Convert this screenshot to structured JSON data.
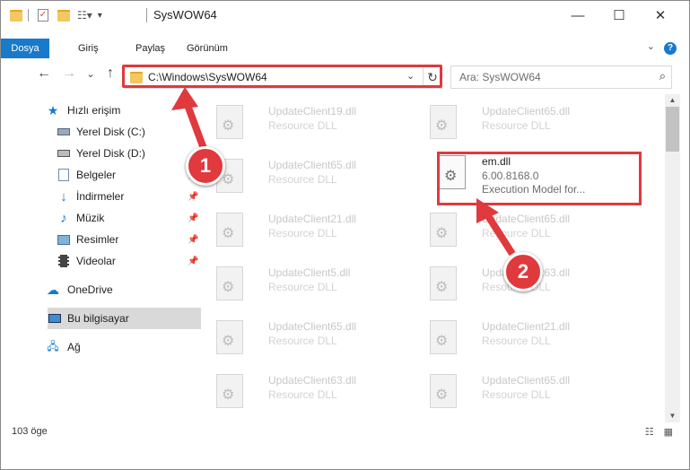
{
  "window": {
    "title": "SysWOW64",
    "controls": {
      "minimize": "—",
      "maximize": "☐",
      "close": "✕"
    }
  },
  "ribbon": {
    "tabs": [
      "Dosya",
      "Giriş",
      "Paylaş",
      "Görünüm"
    ],
    "help": "?"
  },
  "nav": {
    "back": "←",
    "forward": "→",
    "up": "↑",
    "recent": "⌄",
    "address": "C:\\Windows\\SysWOW64",
    "dropdown": "⌄",
    "refresh": "↻",
    "search_placeholder": "Ara: SysWOW64",
    "search_icon": "⌕"
  },
  "sidebar": {
    "quick_access": "Hızlı erişim",
    "items": [
      {
        "label": "Yerel Disk (C:)",
        "icon": "drive-icon",
        "pinned": false
      },
      {
        "label": "Yerel Disk (D:)",
        "icon": "drive-icon",
        "pinned": false
      },
      {
        "label": "Belgeler",
        "icon": "documents-icon",
        "pinned": true
      },
      {
        "label": "İndirmeler",
        "icon": "downloads-icon",
        "pinned": true
      },
      {
        "label": "Müzik",
        "icon": "music-icon",
        "pinned": true
      },
      {
        "label": "Resimler",
        "icon": "pictures-icon",
        "pinned": true
      },
      {
        "label": "Videolar",
        "icon": "videos-icon",
        "pinned": true
      }
    ],
    "onedrive": "OneDrive",
    "this_pc": "Bu bilgisayar",
    "network": "Ağ",
    "pin_glyph": "📌"
  },
  "files": {
    "left": [
      {
        "name": "UpdateClient19.dll",
        "desc": "Resource DLL"
      },
      {
        "name": "UpdateClient65.dll",
        "desc": "Resource DLL"
      },
      {
        "name": "UpdateClient21.dll",
        "desc": "Resource DLL"
      },
      {
        "name": "UpdateClient5.dll",
        "desc": "Resource DLL"
      },
      {
        "name": "UpdateClient65.dll",
        "desc": "Resource DLL"
      },
      {
        "name": "UpdateClient63.dll",
        "desc": "Resource DLL"
      }
    ],
    "right": [
      {
        "name": "UpdateClient65.dll",
        "desc": "Resource DLL"
      },
      {
        "name": "UpdateClient65.dll",
        "desc": "Resource DLL"
      },
      {
        "name": "UpdateClient63.dll",
        "desc": "Resource DLL"
      },
      {
        "name": "UpdateClient21.dll",
        "desc": "Resource DLL"
      },
      {
        "name": "UpdateClient65.dll",
        "desc": "Resource DLL"
      }
    ],
    "focused": {
      "name": "em.dll",
      "version": "6.00.8168.0",
      "desc": "Execution Model for..."
    }
  },
  "status": {
    "count": "103 öge",
    "view_icons": "☷ ▦"
  },
  "annotations": {
    "step1": "1",
    "step2": "2",
    "color": "#e0393e"
  }
}
